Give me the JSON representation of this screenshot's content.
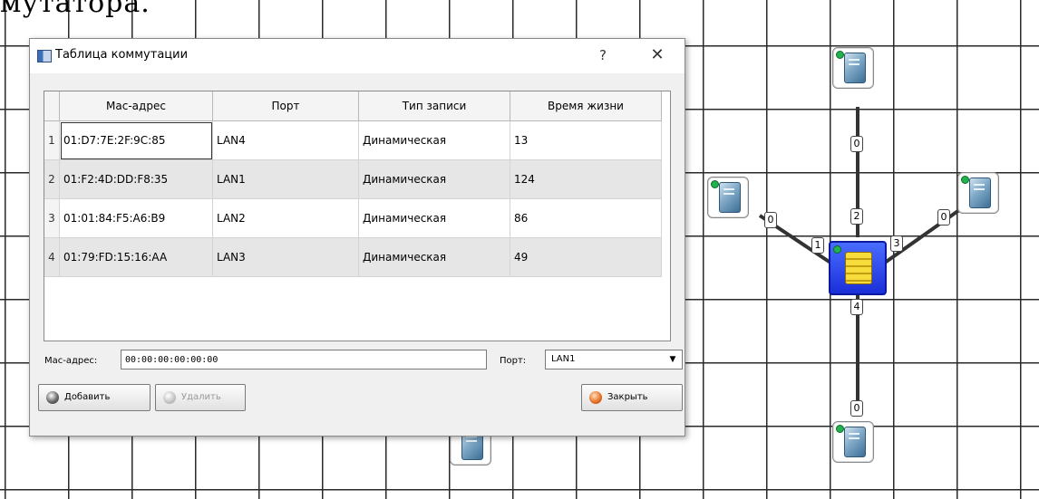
{
  "page_heading": "мутатора.",
  "network": {
    "switch": {
      "ports": [
        "1",
        "2",
        "3",
        "4"
      ]
    },
    "hosts": [
      {
        "id": "top",
        "port": "0"
      },
      {
        "id": "left",
        "port": "0"
      },
      {
        "id": "right",
        "port": "0"
      },
      {
        "id": "bottom",
        "port": "0"
      },
      {
        "id": "lower-middle"
      }
    ]
  },
  "dialog": {
    "title": "Таблица коммутации",
    "help_label": "?",
    "close_label": "✕",
    "columns": [
      "Мас-адрес",
      "Порт",
      "Тип записи",
      "Время жизни"
    ],
    "rows": [
      {
        "n": "1",
        "mac": "01:D7:7E:2F:9C:85",
        "port": "LAN4",
        "type": "Динамическая",
        "ttl": "13"
      },
      {
        "n": "2",
        "mac": "01:F2:4D:DD:F8:35",
        "port": "LAN1",
        "type": "Динамическая",
        "ttl": "124"
      },
      {
        "n": "3",
        "mac": "01:01:84:F5:A6:B9",
        "port": "LAN2",
        "type": "Динамическая",
        "ttl": "86"
      },
      {
        "n": "4",
        "mac": "01:79:FD:15:16:AA",
        "port": "LAN3",
        "type": "Динамическая",
        "ttl": "49"
      }
    ],
    "mac_label": "Мас-адрес:",
    "mac_value": "00:00:00:00:00:00",
    "port_label": "Порт:",
    "port_value": "LAN1",
    "add_label": "Добавить",
    "delete_label": "Удалить",
    "close_button_label": "Закрыть"
  }
}
